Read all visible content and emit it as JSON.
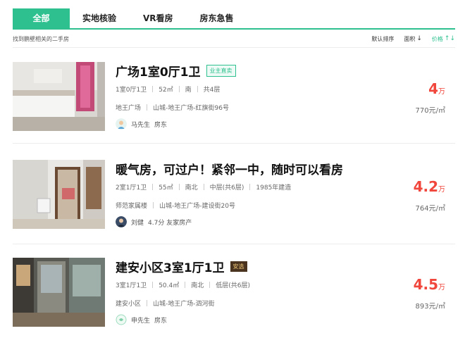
{
  "tabs": [
    {
      "label": "全部",
      "active": true
    },
    {
      "label": "实地核验",
      "active": false
    },
    {
      "label": "VR看房",
      "active": false
    },
    {
      "label": "房东急售",
      "active": false
    }
  ],
  "subheader": {
    "hint": "找到鹏壁相关的二手房",
    "sorts": [
      {
        "label": "默认排序",
        "arrow": "",
        "active": false
      },
      {
        "label": "面积",
        "arrow": "↓",
        "active": false
      },
      {
        "label": "价格",
        "arrow": "↑↓",
        "active": true
      }
    ]
  },
  "listings": [
    {
      "title": "广场1室0厅1卫",
      "badge": "业主直卖",
      "details": [
        "1室0厅1卫",
        "52㎡",
        "南",
        "共4层"
      ],
      "location": [
        "地王广场",
        "山城-地王广场-红旗街96号"
      ],
      "agent_name": "马先生",
      "agent_info": "房东",
      "price": "4",
      "price_unit": "万",
      "unit_price": "770元/㎡"
    },
    {
      "title": "暖气房，可过户！紧邻一中，随时可以看房",
      "badge": "",
      "details": [
        "2室1厅1卫",
        "55㎡",
        "南北",
        "中层(共6层)",
        "1985年建造"
      ],
      "location": [
        "师范家属楼",
        "山城-地王广场-建设街20号"
      ],
      "agent_name": "刘健",
      "agent_info": "4.7分  友家房产",
      "price": "4.2",
      "price_unit": "万",
      "unit_price": "764元/㎡"
    },
    {
      "title": "建安小区3室1厅1卫",
      "badge": "安选",
      "details": [
        "3室1厅1卫",
        "50.4㎡",
        "南北",
        "低层(共6层)"
      ],
      "location": [
        "建安小区",
        "山城-地王广场-泗河街"
      ],
      "agent_name": "申先生",
      "agent_info": "房东",
      "price": "4.5",
      "price_unit": "万",
      "unit_price": "893元/㎡"
    }
  ],
  "colors": {
    "accent": "#2ec18f",
    "price": "#f0463c"
  }
}
